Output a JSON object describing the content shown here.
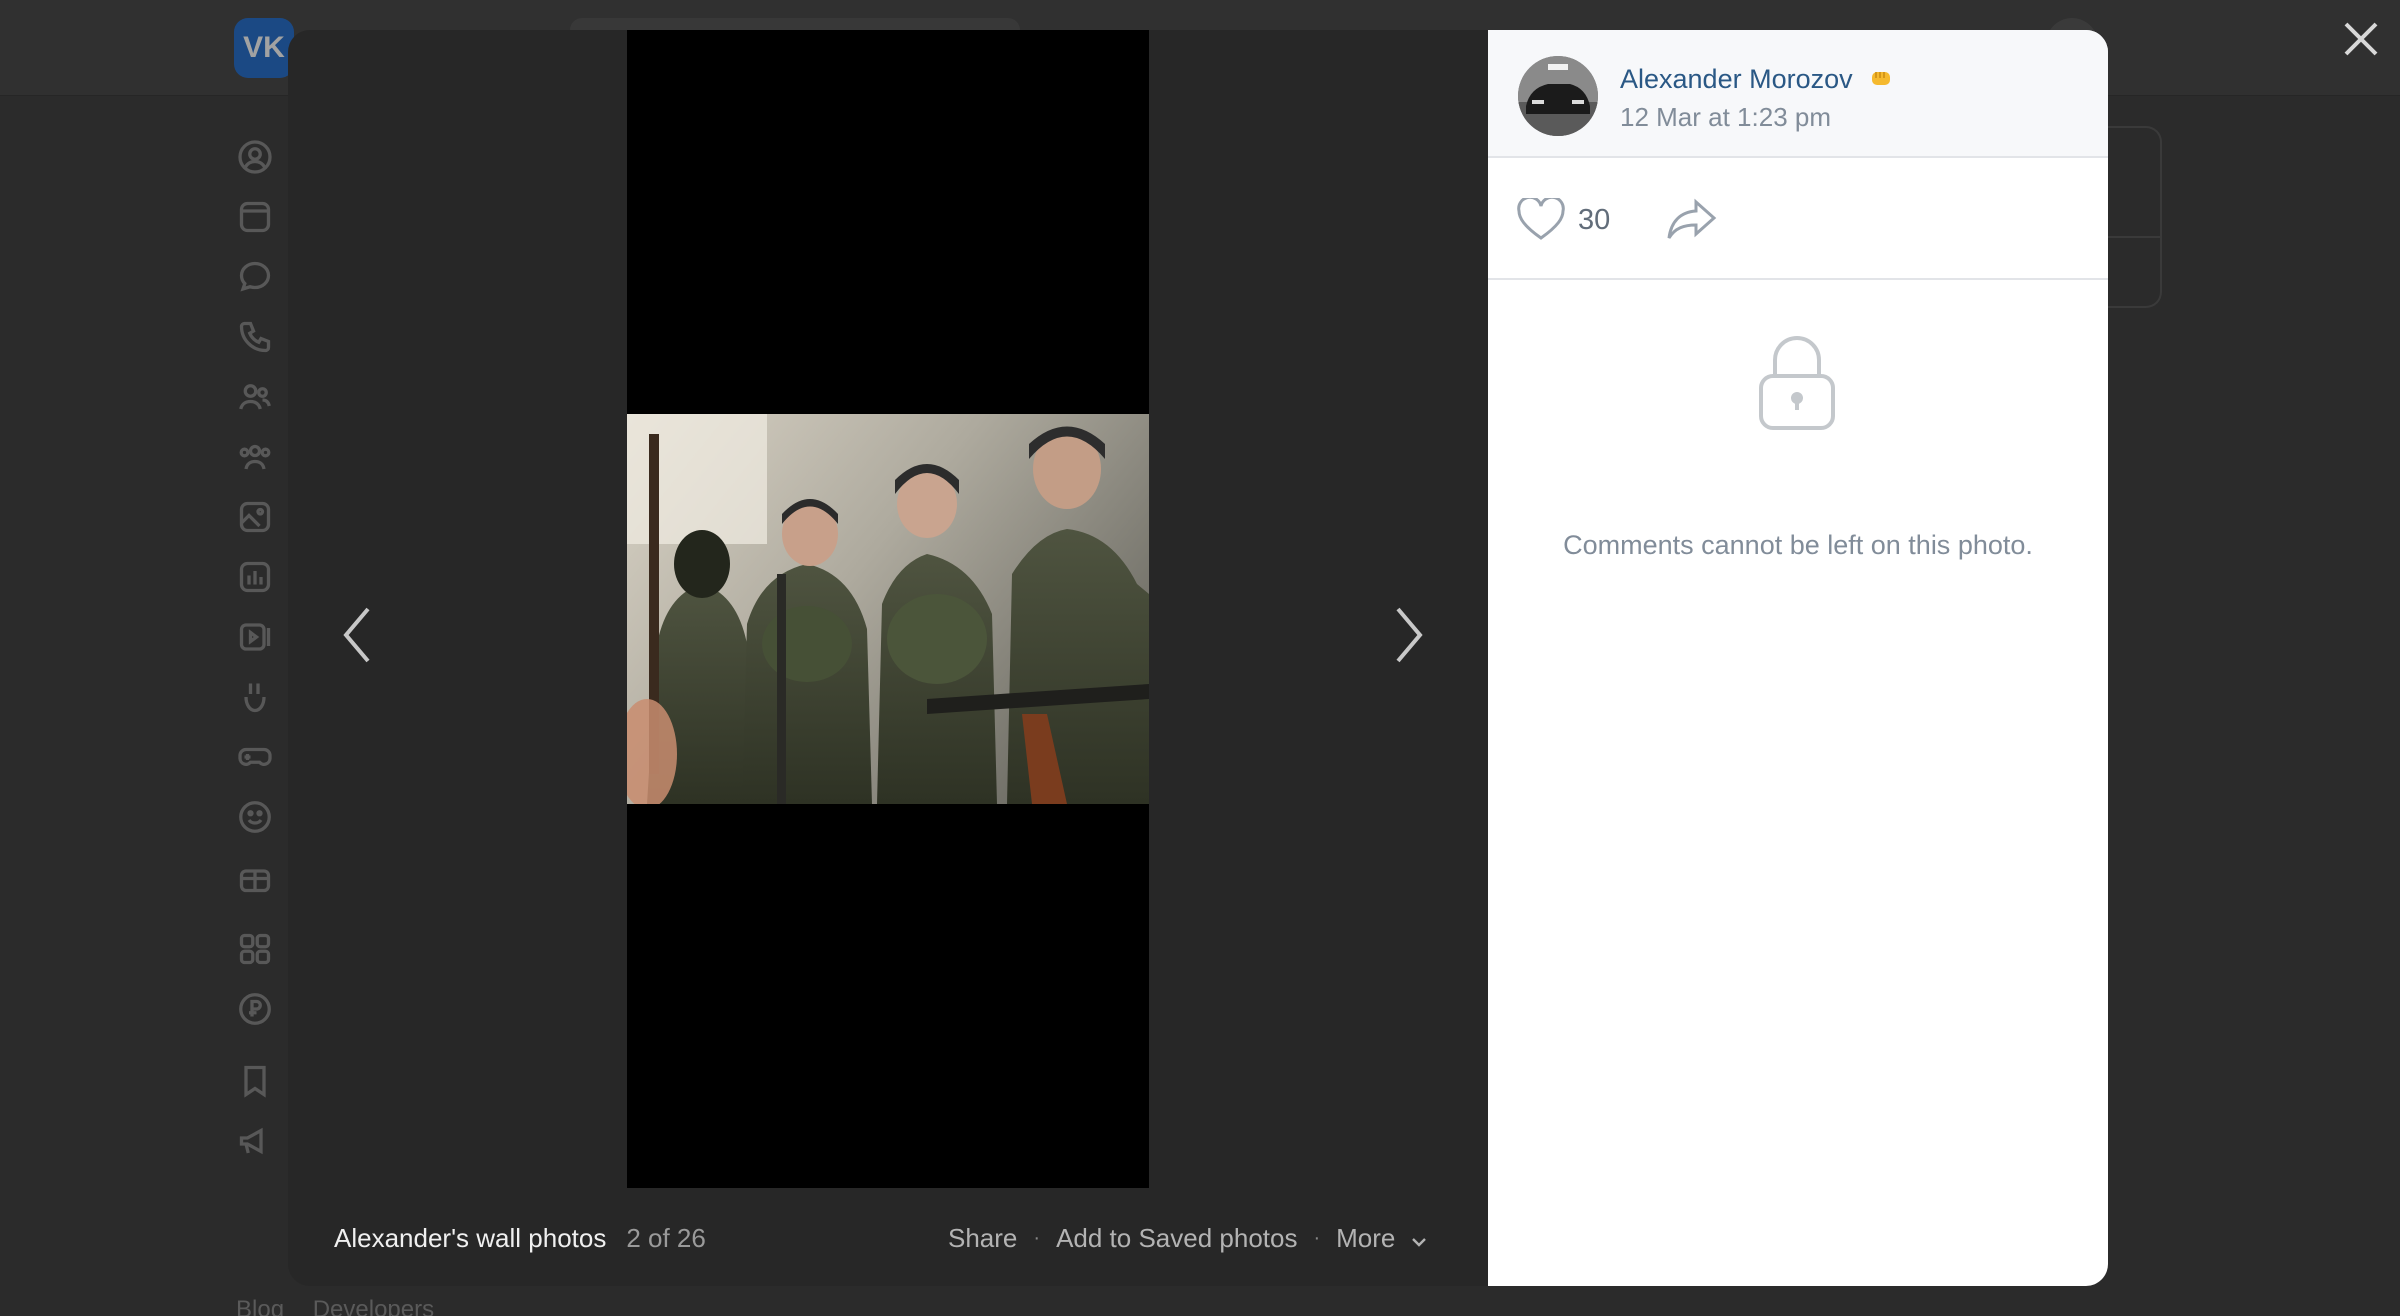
{
  "background": {
    "logo_text": "VK",
    "footer_links": [
      "Blog",
      "Developers"
    ],
    "sidebar_icons": [
      "profile-icon",
      "news-icon",
      "messenger-icon",
      "calls-icon",
      "friends-icon",
      "communities-icon",
      "photos-icon",
      "music-icon",
      "video-icon",
      "clips-icon",
      "games-icon",
      "stickers-icon",
      "gifts-icon",
      "mini-apps-icon",
      "payments-icon",
      "bookmarks-icon",
      "ads-icon"
    ]
  },
  "viewer": {
    "album_title": "Alexander's wall photos",
    "counter": "2 of 26",
    "actions": {
      "share": "Share",
      "save": "Add to Saved photos",
      "more": "More"
    },
    "author": {
      "name": "Alexander Morozov",
      "date": "12 Mar at 1:23 pm"
    },
    "likes": "30",
    "comments_locked_message": "Comments cannot be left on this photo."
  },
  "colors": {
    "link": "#2a5885",
    "muted": "#818c99",
    "overlay": "#2b2b2b"
  }
}
